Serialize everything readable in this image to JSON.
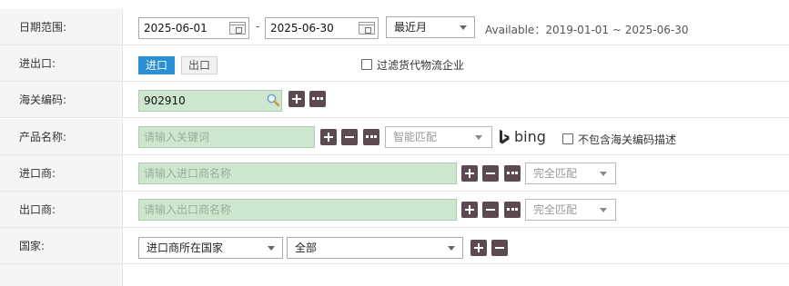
{
  "date_range": {
    "label": "日期范围:",
    "start": "2025-06-01",
    "separator": "-",
    "end": "2025-06-30",
    "preset": "最近月",
    "available": "Available：2019-01-01 ~ 2025-06-30"
  },
  "trade_direction": {
    "label": "进出口:",
    "options": [
      "进口",
      "出口"
    ],
    "selected": "进口",
    "filter_logistics_label": "过滤货代物流企业"
  },
  "hs_code": {
    "label": "海关编码:",
    "value": "902910"
  },
  "product": {
    "label": "产品名称:",
    "placeholder": "请输入关键词",
    "match_mode": "智能匹配",
    "bing_label": "bing",
    "exclude_desc_label": "不包含海关编码描述"
  },
  "importer": {
    "label": "进口商:",
    "placeholder": "请输入进口商名称",
    "match_mode": "完全匹配"
  },
  "exporter": {
    "label": "出口商:",
    "placeholder": "请输入出口商名称",
    "match_mode": "完全匹配"
  },
  "country": {
    "label": "国家:",
    "scope": "进口商所在国家",
    "value": "全部"
  },
  "colors": {
    "accent_blue": "#2b8fd6",
    "input_green": "#cde7cf",
    "button_dark": "#5d4a50"
  }
}
